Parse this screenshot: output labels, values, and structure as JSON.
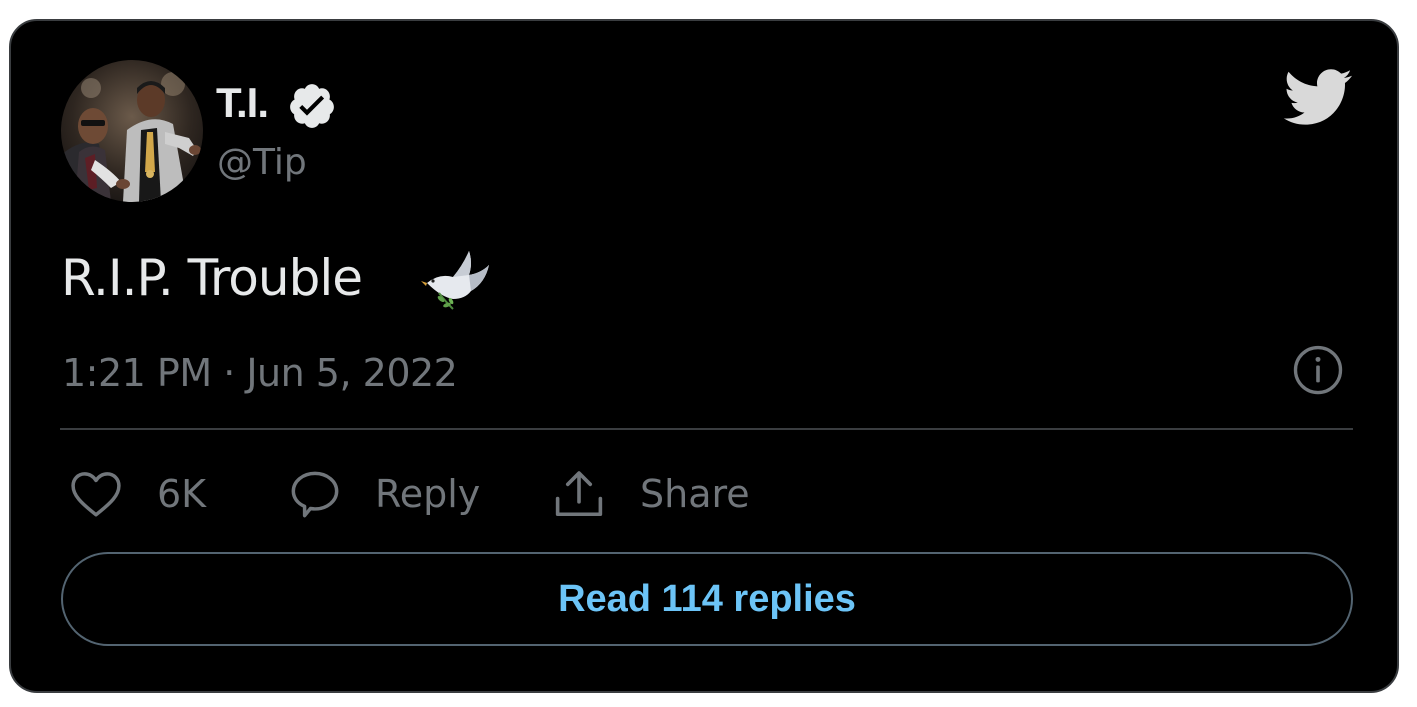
{
  "author": {
    "display_name": "T.I.",
    "handle": "@Tip",
    "verified": true,
    "avatar": "profile-photo"
  },
  "tweet": {
    "text": "R.I.P. Trouble",
    "emoji": "dove-emoji",
    "timestamp": "1:21 PM · Jun 5, 2022"
  },
  "actions": {
    "like_count": "6K",
    "reply_label": "Reply",
    "share_label": "Share"
  },
  "read_replies_label": "Read 114 replies",
  "icons": {
    "brand": "twitter-bird-icon",
    "verified": "verified-badge-icon",
    "info": "info-icon",
    "like": "heart-icon",
    "reply": "speech-bubble-icon",
    "share": "share-upload-icon"
  },
  "colors": {
    "background": "#000000",
    "text_primary": "#e7e9ea",
    "text_secondary": "#71767b",
    "link": "#6cc4f7",
    "border": "#536471"
  }
}
